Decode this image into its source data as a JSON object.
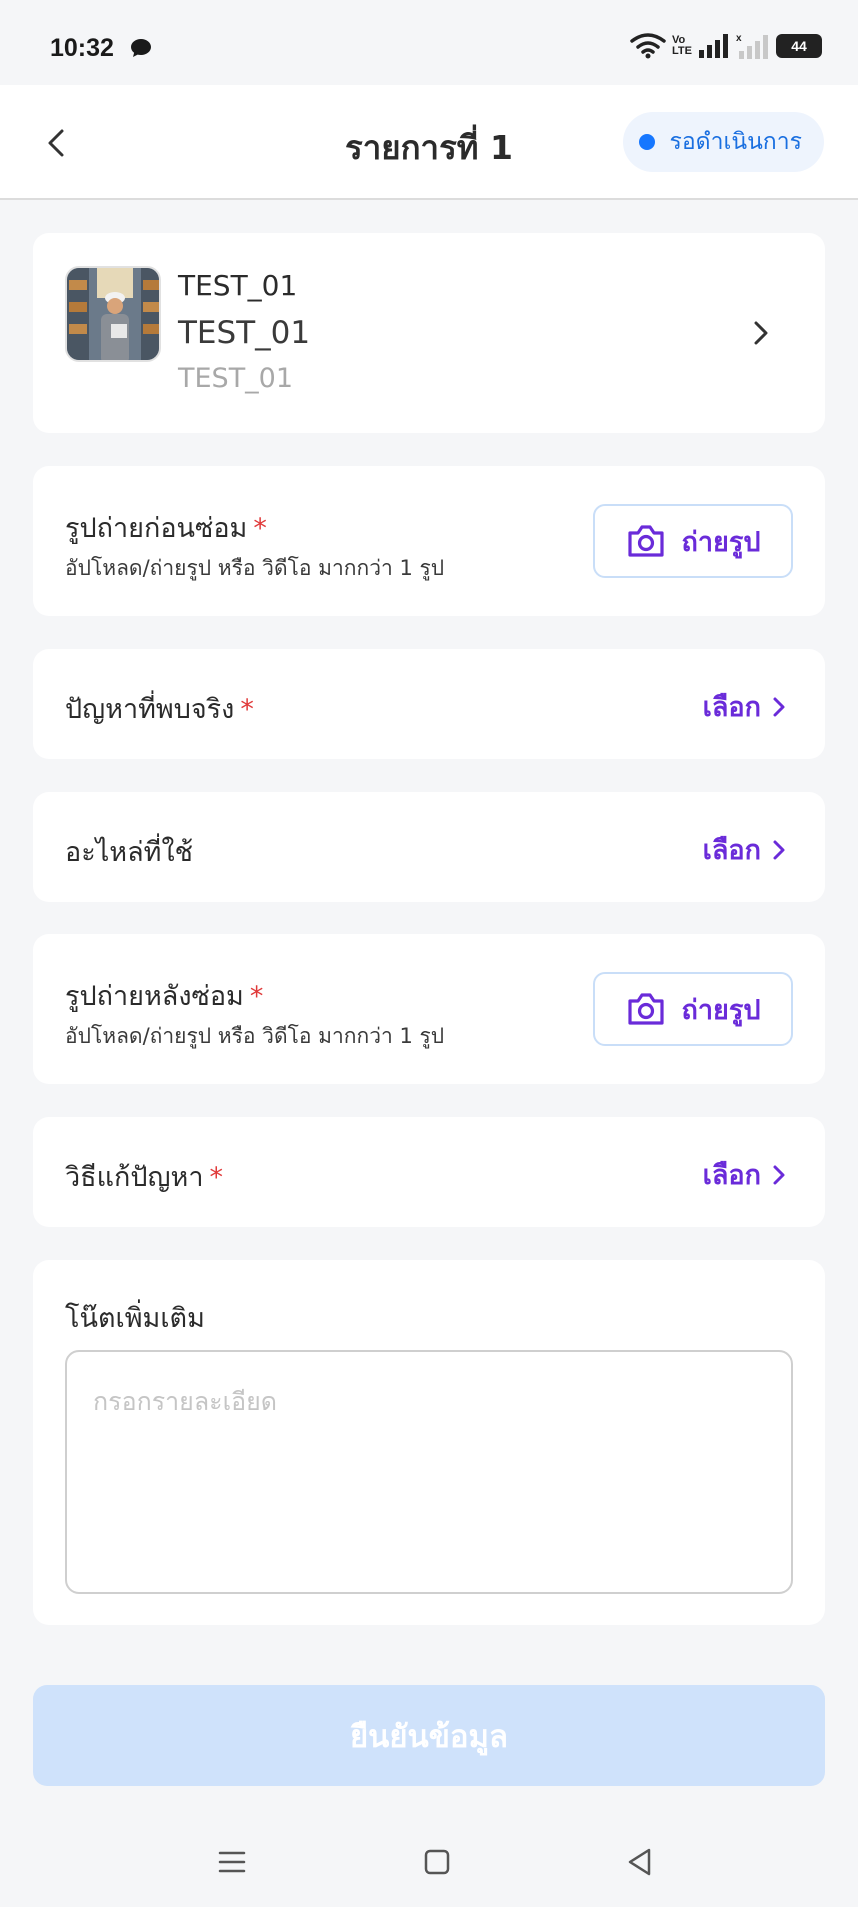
{
  "status_bar": {
    "time": "10:32",
    "volte_top": "Vo",
    "volte_bottom": "LTE",
    "battery": "44"
  },
  "header": {
    "title": "รายการที่ 1",
    "status": "รอดำเนินการ",
    "status_color": "#1677ff"
  },
  "product": {
    "line1": "TEST_01",
    "line2": "TEST_01",
    "line3": "TEST_01"
  },
  "before_photo": {
    "title": "รูปถ่ายก่อนซ่อม",
    "required_mark": "*",
    "hint": "อัปโหลด/ถ่ายรูป หรือ วิดีโอ มากกว่า 1 รูป",
    "button_label": "ถ่ายรูป"
  },
  "problem": {
    "title": "ปัญหาที่พบจริง",
    "required_mark": "*",
    "action_label": "เลือก"
  },
  "parts": {
    "title": "อะไหล่ที่ใช้",
    "action_label": "เลือก"
  },
  "after_photo": {
    "title": "รูปถ่ายหลังซ่อม",
    "required_mark": "*",
    "hint": "อัปโหลด/ถ่ายรูป หรือ วิดีโอ มากกว่า 1 รูป",
    "button_label": "ถ่ายรูป"
  },
  "solution": {
    "title": "วิธีแก้ปัญหา",
    "required_mark": "*",
    "action_label": "เลือก"
  },
  "note": {
    "title": "โน๊ตเพิ่มเติม",
    "placeholder": "กรอกรายละเอียด",
    "value": ""
  },
  "confirm": {
    "label": "ยืนยันข้อมูล"
  },
  "colors": {
    "accent": "#6a2bd9",
    "required": "#e03a3a",
    "confirm_disabled": "#cfe2fb"
  }
}
